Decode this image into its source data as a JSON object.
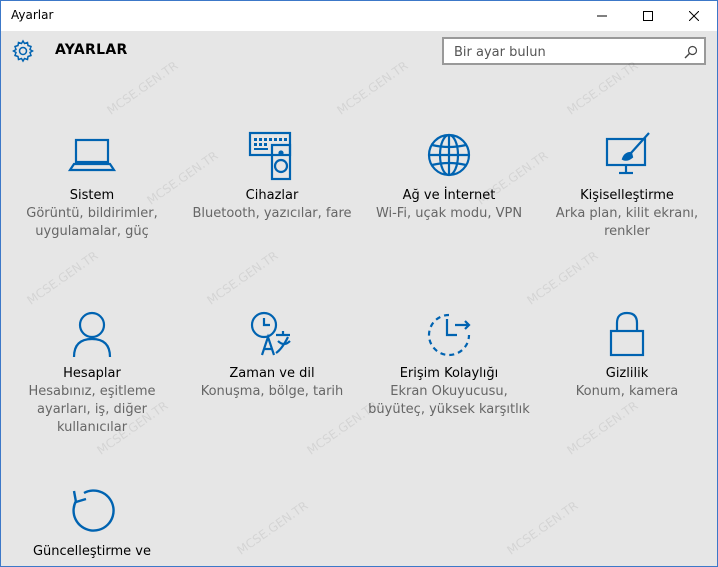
{
  "window": {
    "title": "Ayarlar",
    "controls": {
      "minimize": "—",
      "maximize": "☐",
      "close": "✕"
    }
  },
  "header": {
    "title": "AYARLAR",
    "search_placeholder": "Bir ayar bulun"
  },
  "tiles": [
    {
      "label": "Sistem",
      "desc": [
        "Görüntü, bildirimler,",
        "uygulamalar, güç"
      ],
      "icon": "laptop-icon"
    },
    {
      "label": "Cihazlar",
      "desc": [
        "Bluetooth, yazıcılar, fare"
      ],
      "icon": "devices-icon"
    },
    {
      "label": "Ağ ve İnternet",
      "desc": [
        "Wi-Fi, uçak modu, VPN"
      ],
      "icon": "globe-icon"
    },
    {
      "label": "Kişiselleştirme",
      "desc": [
        "Arka plan, kilit ekranı,",
        "renkler"
      ],
      "icon": "personalization-icon"
    },
    {
      "label": "Hesaplar",
      "desc": [
        "Hesabınız, eşitleme",
        "ayarları, iş, diğer",
        "kullanıcılar"
      ],
      "icon": "person-icon"
    },
    {
      "label": "Zaman ve dil",
      "desc": [
        "Konuşma, bölge, tarih"
      ],
      "icon": "time-language-icon"
    },
    {
      "label": "Erişim Kolaylığı",
      "desc": [
        "Ekran Okuyucusu,",
        "büyüteç, yüksek karşıtlık"
      ],
      "icon": "ease-of-access-icon"
    },
    {
      "label": "Gizlilik",
      "desc": [
        "Konum, kamera"
      ],
      "icon": "lock-icon"
    },
    {
      "label": "Güncelleştirme ve",
      "desc": [],
      "icon": "update-icon"
    }
  ],
  "watermark": "MCSE.GEN.TR",
  "colors": {
    "accent": "#0063b1",
    "background": "#e6e6e6"
  }
}
